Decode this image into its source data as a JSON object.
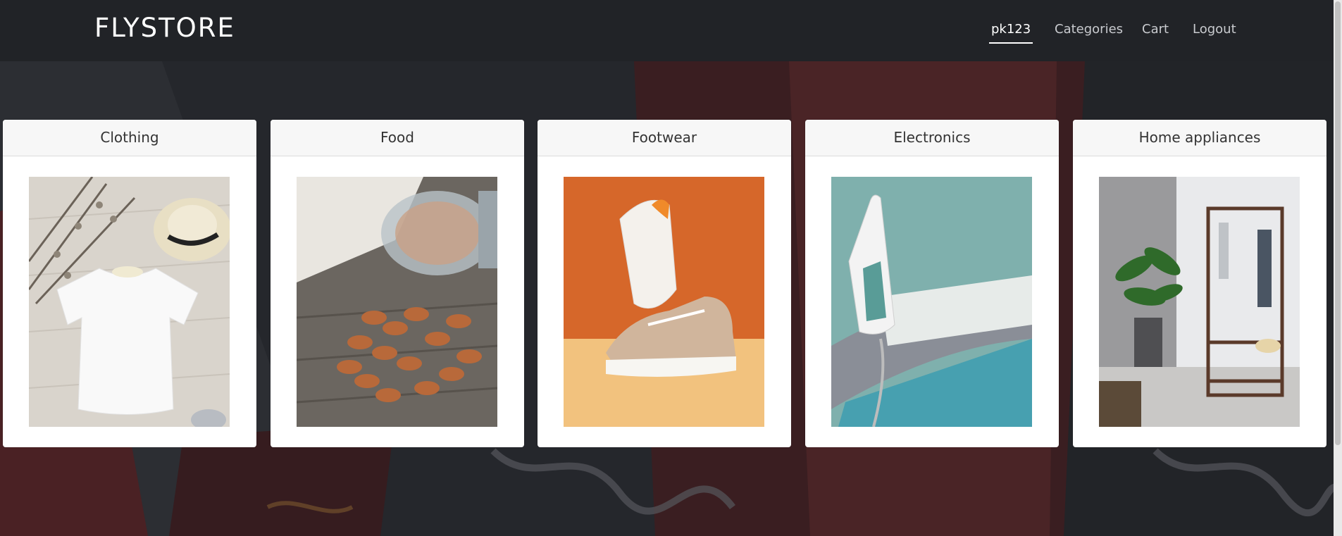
{
  "brand": {
    "name": "FLYSTORE"
  },
  "nav": {
    "items": [
      {
        "label": "pk123",
        "active": true
      },
      {
        "label": "Categories",
        "active": false
      },
      {
        "label": "Cart",
        "active": false
      },
      {
        "label": "Logout",
        "active": false
      }
    ]
  },
  "categories": [
    {
      "title": "Clothing",
      "image": "white-tshirt-hat-photo"
    },
    {
      "title": "Food",
      "image": "almonds-jar-photo"
    },
    {
      "title": "Footwear",
      "image": "sneakers-photo"
    },
    {
      "title": "Electronics",
      "image": "iron-ironing-board-photo"
    },
    {
      "title": "Home appliances",
      "image": "clothes-rack-room-photo"
    }
  ],
  "colors": {
    "navbar": "#212327",
    "page_background": "#1f2126",
    "card": "#ffffff",
    "card_header": "#f7f7f7"
  }
}
